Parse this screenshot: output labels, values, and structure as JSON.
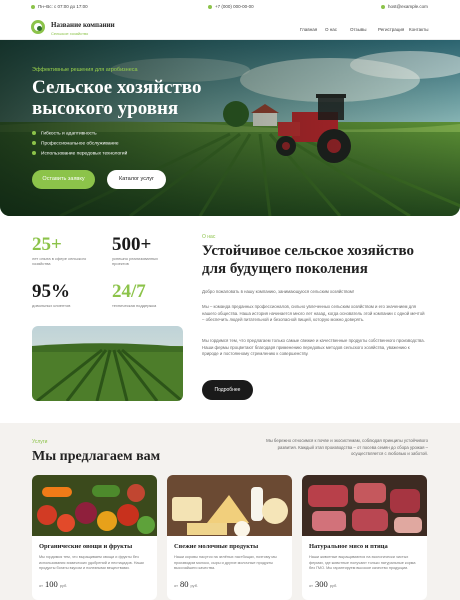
{
  "topbar": {
    "hours": "Пн–Вс: с 07:00 до 17:00",
    "phone": "+7 (000) 000-00-00",
    "email": "host@example.com"
  },
  "brand": {
    "name": "Название компании",
    "tagline": "Сельское хозяйство"
  },
  "nav": {
    "items": [
      "Главная",
      "О нас",
      "Отзывы",
      "Регистрация",
      "Контакты"
    ],
    "cta_label": ""
  },
  "hero": {
    "eyebrow": "Эффективные решения для агробизнеса",
    "title": "Сельское хозяйство высокого уровня",
    "features": [
      "Гибкость и адаптивность",
      "Профессиональное обслуживание",
      "Использование передовых технологий"
    ],
    "primary_button": "Оставить заявку",
    "secondary_button": "Каталог услуг"
  },
  "stats": [
    {
      "value": "25+",
      "label": "лет опыта в сфере сельского хозяйства"
    },
    {
      "value": "500+",
      "label": "успешно реализованных проектов"
    },
    {
      "value": "95%",
      "label": "довольных клиентов"
    },
    {
      "value": "24/7",
      "label": "техническая поддержка"
    }
  ],
  "about": {
    "eyebrow": "О нас",
    "title": "Устойчивое сельское хозяйство для будущего поколения",
    "p1": "Добро пожаловать в нашу компанию, занимающуюся сельским хозяйством!",
    "p2": "Мы – команда преданных профессионалов, сильно увлеченных сельским хозяйством и его значением для нашего общества. Наша история начинается много лет назад, когда основатель этой компании с одной мечтой – обеспечить людей питательной и безопасной пищей, которую можно доверять.",
    "p3": "Мы гордимся тем, что предлагаем только самые свежие и качественные продукты собственного производства. Наши фермы процветают благодаря применению передовых методов сельского хозяйства, уважению к природе и постоянному стремлению к совершенству.",
    "button": "Подробнее"
  },
  "services": {
    "eyebrow": "Услуги",
    "title": "Мы предлагаем вам",
    "intro": "Мы бережно относимся к почве и экосистемам, соблюдая принципы устойчивого развития. Каждый этап производства – от посева семян до сбора урожая – осуществляется с любовью и заботой.",
    "cards": [
      {
        "title": "Органические овощи и фрукты",
        "desc": "Мы гордимся тем, что выращиваем овощи и фрукты без использования химических удобрений и пестицидов. Наши продукты богаты вкусом и полезными веществами.",
        "price_prefix": "от",
        "price": "100",
        "unit": "руб."
      },
      {
        "title": "Свежие молочные продукты",
        "desc": "Наши коровы пасутся на зелёных пастбищах, поэтому мы производим молоко, сыры и другие молочные продукты высочайшего качества.",
        "price_prefix": "от",
        "price": "80",
        "unit": "руб."
      },
      {
        "title": "Натуральное мясо и птица",
        "desc": "Наши животные выращиваются на экологически чистых фермах, где животные получают только натуральные корма без ГМО. Мы гарантируем высокое качество продукции.",
        "price_prefix": "от",
        "price": "300",
        "unit": "руб."
      }
    ]
  },
  "colors": {
    "accent": "#8cc34a",
    "dark": "#1a1a1a",
    "section_bg": "#f4f2ef"
  }
}
